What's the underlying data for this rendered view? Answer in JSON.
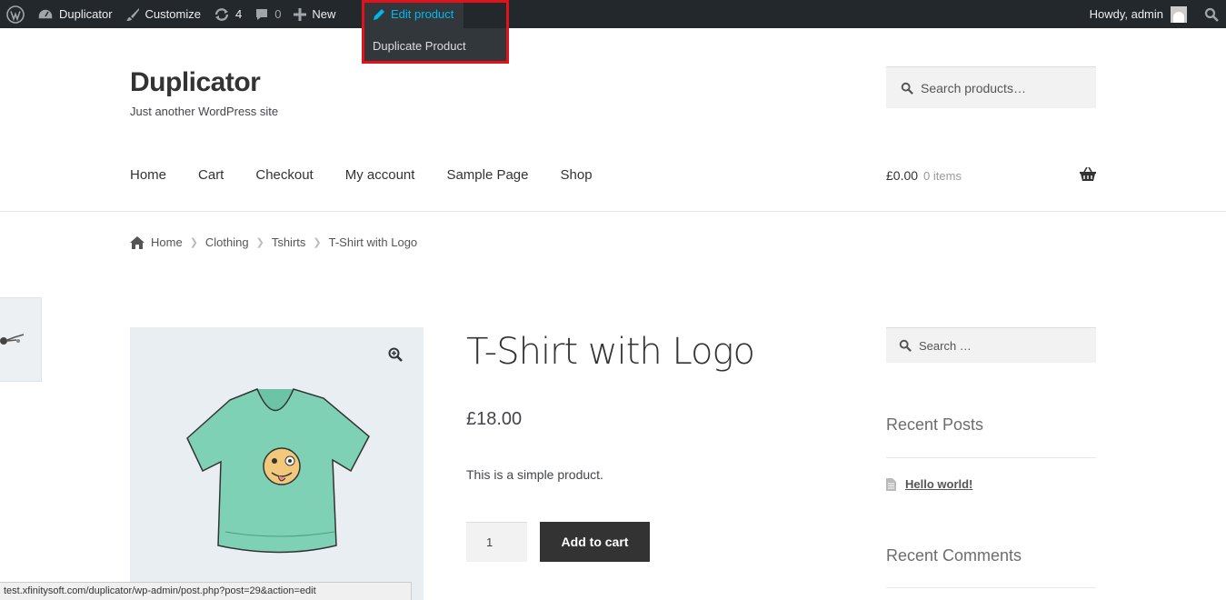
{
  "adminbar": {
    "site_name": "Duplicator",
    "customize": "Customize",
    "updates_count": "4",
    "comments_count": "0",
    "new_label": "New",
    "edit_product": "Edit product",
    "dropdown_item": "Duplicate Product",
    "howdy": "Howdy, admin"
  },
  "header": {
    "site_title": "Duplicator",
    "site_description": "Just another WordPress site",
    "search_placeholder": "Search products…",
    "nav": [
      "Home",
      "Cart",
      "Checkout",
      "My account",
      "Sample Page",
      "Shop"
    ],
    "cart_total": "£0.00",
    "cart_items": "0 items"
  },
  "breadcrumb": [
    "Home",
    "Clothing",
    "Tshirts",
    "T-Shirt with Logo"
  ],
  "product": {
    "title": "T-Shirt with Logo",
    "price": "£18.00",
    "description": "This is a simple product.",
    "quantity": "1",
    "add_to_cart": "Add to cart"
  },
  "sidebar": {
    "search_placeholder": "Search …",
    "recent_posts_title": "Recent Posts",
    "recent_post_1": "Hello world!",
    "recent_comments_title": "Recent Comments"
  },
  "statusbar": {
    "url": "test.xfinitysoft.com/duplicator/wp-admin/post.php?post=29&action=edit"
  },
  "colors": {
    "adminbar_bg": "#23282d",
    "highlight": "#e0121c",
    "link_active": "#00b9eb",
    "button_bg": "#333333"
  }
}
